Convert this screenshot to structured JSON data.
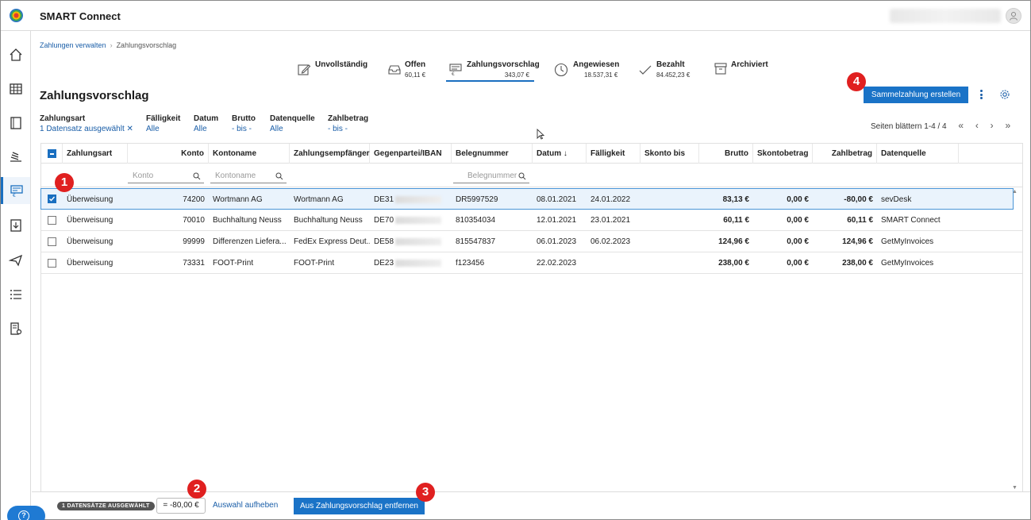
{
  "app": {
    "title": "SMART Connect"
  },
  "breadcrumb": {
    "parent": "Zahlungen verwalten",
    "current": "Zahlungsvorschlag"
  },
  "status_tabs": [
    {
      "label": "Unvollständig",
      "value": ""
    },
    {
      "label": "Offen",
      "value": "60,11 €"
    },
    {
      "label": "Zahlungsvorschlag",
      "value": "343,07 €"
    },
    {
      "label": "Angewiesen",
      "value": "18.537,31 €"
    },
    {
      "label": "Bezahlt",
      "value": "84.452,23 €"
    },
    {
      "label": "Archiviert",
      "value": ""
    }
  ],
  "page": {
    "title": "Zahlungsvorschlag",
    "primary_action": "Sammelzahlung erstellen"
  },
  "filters": [
    {
      "label": "Zahlungsart",
      "value": "1 Datensatz ausgewählt ✕"
    },
    {
      "label": "Fälligkeit",
      "value": "Alle"
    },
    {
      "label": "Datum",
      "value": "Alle"
    },
    {
      "label": "Brutto",
      "value": "- bis -"
    },
    {
      "label": "Datenquelle",
      "value": "Alle"
    },
    {
      "label": "Zahlbetrag",
      "value": "- bis -"
    }
  ],
  "pager": {
    "text": "Seiten blättern 1-4 / 4"
  },
  "table": {
    "columns": [
      "Zahlungsart",
      "Konto",
      "Kontoname",
      "Zahlungsempfänger",
      "Gegenpartei/IBAN",
      "Belegnummer",
      "Datum ↓",
      "Fälligkeit",
      "Skonto bis",
      "Brutto",
      "Skontobetrag",
      "Zahlbetrag",
      "Datenquelle"
    ],
    "filter_placeholders": {
      "konto": "Konto",
      "kontoname": "Kontoname",
      "belegnummer": "Belegnummer"
    },
    "rows": [
      {
        "selected": true,
        "zahlungsart": "Überweisung",
        "konto": "74200",
        "kontoname": "Wortmann AG",
        "empfaenger": "Wortmann AG",
        "iban": "DE31",
        "beleg": "DR5997529",
        "datum": "08.01.2021",
        "faelligkeit": "24.01.2022",
        "skonto_bis": "",
        "brutto": "83,13 €",
        "skontobetrag": "0,00 €",
        "zahlbetrag": "-80,00 €",
        "quelle": "sevDesk"
      },
      {
        "selected": false,
        "zahlungsart": "Überweisung",
        "konto": "70010",
        "kontoname": "Buchhaltung Neuss",
        "empfaenger": "Buchhaltung Neuss",
        "iban": "DE70",
        "beleg": "810354034",
        "datum": "12.01.2021",
        "faelligkeit": "23.01.2021",
        "skonto_bis": "",
        "brutto": "60,11 €",
        "skontobetrag": "0,00 €",
        "zahlbetrag": "60,11 €",
        "quelle": "SMART Connect"
      },
      {
        "selected": false,
        "zahlungsart": "Überweisung",
        "konto": "99999",
        "kontoname": "Differenzen Liefera...",
        "empfaenger": "FedEx Express Deut...",
        "iban": "DE58",
        "beleg": "815547837",
        "datum": "06.01.2023",
        "faelligkeit": "06.02.2023",
        "skonto_bis": "",
        "brutto": "124,96 €",
        "skontobetrag": "0,00 €",
        "zahlbetrag": "124,96 €",
        "quelle": "GetMyInvoices"
      },
      {
        "selected": false,
        "zahlungsart": "Überweisung",
        "konto": "73331",
        "kontoname": "FOOT-Print",
        "empfaenger": "FOOT-Print",
        "iban": "DE23",
        "beleg": "f123456",
        "datum": "22.02.2023",
        "faelligkeit": "",
        "skonto_bis": "",
        "brutto": "238,00 €",
        "skontobetrag": "0,00 €",
        "zahlbetrag": "238,00 €",
        "quelle": "GetMyInvoices"
      }
    ]
  },
  "footer": {
    "selected_badge": "1 DATENSÄTZE AUSGEWÄHLT",
    "sum": "= -80,00 €",
    "clear_selection": "Auswahl aufheben",
    "remove_button": "Aus Zahlungsvorschlag entfernen"
  },
  "markers": [
    "1",
    "2",
    "3",
    "4"
  ],
  "colors": {
    "accent": "#1a73c7",
    "marker": "#e02020",
    "selected_row": "#eaf3fc"
  }
}
